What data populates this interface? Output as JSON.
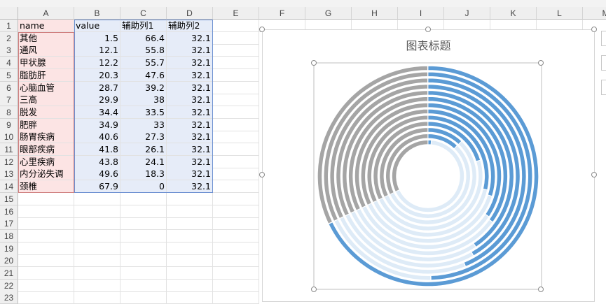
{
  "sheet": {
    "columns": [
      "A",
      "B",
      "C",
      "D",
      "E",
      "F",
      "G",
      "H",
      "I",
      "J",
      "K",
      "L",
      "M"
    ],
    "rows": [
      "1",
      "2",
      "3",
      "4",
      "5",
      "6",
      "7",
      "8",
      "9",
      "10",
      "11",
      "12",
      "13",
      "14",
      "15",
      "16",
      "17",
      "18",
      "19",
      "20",
      "21",
      "22",
      "23"
    ],
    "header_row": [
      "name",
      "value",
      "辅助列1",
      "辅助列2"
    ],
    "data": [
      [
        "其他",
        "1.5",
        "66.4",
        "32.1"
      ],
      [
        "通风",
        "12.1",
        "55.8",
        "32.1"
      ],
      [
        "甲状腺",
        "12.2",
        "55.7",
        "32.1"
      ],
      [
        "脂肪肝",
        "20.3",
        "47.6",
        "32.1"
      ],
      [
        "心脑血管",
        "28.7",
        "39.2",
        "32.1"
      ],
      [
        "三高",
        "29.9",
        "38",
        "32.1"
      ],
      [
        "脱发",
        "34.4",
        "33.5",
        "32.1"
      ],
      [
        "肥胖",
        "34.9",
        "33",
        "32.1"
      ],
      [
        "肠胃疾病",
        "40.6",
        "27.3",
        "32.1"
      ],
      [
        "眼部疾病",
        "41.8",
        "26.1",
        "32.1"
      ],
      [
        "心里疾病",
        "43.8",
        "24.1",
        "32.1"
      ],
      [
        "内分泌失调",
        "49.6",
        "18.3",
        "32.1"
      ],
      [
        "颈椎",
        "67.9",
        "0",
        "32.1"
      ]
    ]
  },
  "chart": {
    "title": "图表标题"
  },
  "colors": {
    "value": "#5b9bd5",
    "aux1": "#deebf7",
    "aux2": "#a5a5a5",
    "name_fill": "#fce4e4",
    "data_fill": "#e6ecf8"
  },
  "chart_data": {
    "type": "doughnut",
    "title": "图表标题",
    "categories": [
      "其他",
      "通风",
      "甲状腺",
      "脂肪肝",
      "心脑血管",
      "三高",
      "脱发",
      "肥胖",
      "肠胃疾病",
      "眼部疾病",
      "心里疾病",
      "内分泌失调",
      "颈椎"
    ],
    "series": [
      {
        "name": "value",
        "values": [
          1.5,
          12.1,
          12.2,
          20.3,
          28.7,
          29.9,
          34.4,
          34.9,
          40.6,
          41.8,
          43.8,
          49.6,
          67.9
        ]
      },
      {
        "name": "辅助列1",
        "values": [
          66.4,
          55.8,
          55.7,
          47.6,
          39.2,
          38,
          33.5,
          33,
          27.3,
          26.1,
          24.1,
          18.3,
          0
        ]
      },
      {
        "name": "辅助列2",
        "values": [
          32.1,
          32.1,
          32.1,
          32.1,
          32.1,
          32.1,
          32.1,
          32.1,
          32.1,
          32.1,
          32.1,
          32.1,
          32.1
        ]
      }
    ]
  }
}
